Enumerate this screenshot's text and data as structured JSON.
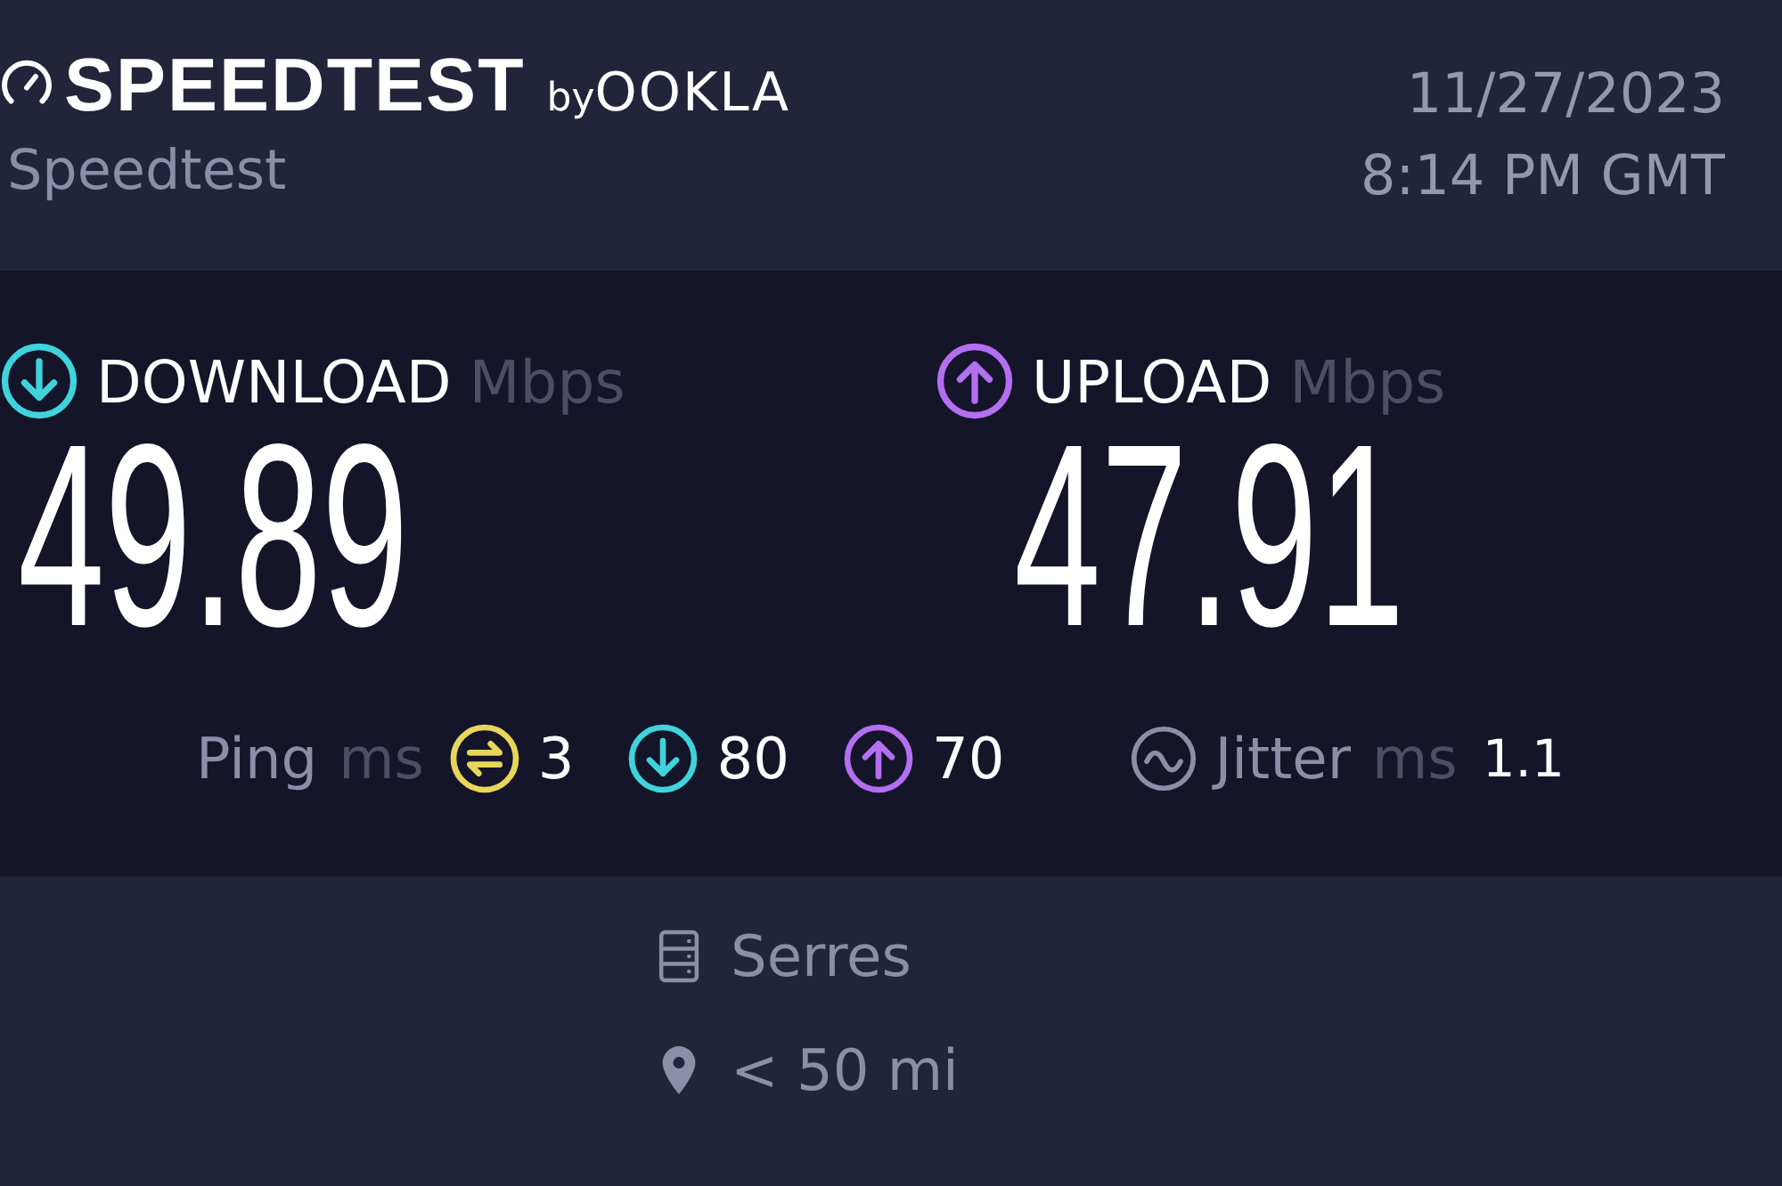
{
  "header": {
    "logo": "SPEEDTEST",
    "logo_by": "by",
    "logo_brand": "OOKLA",
    "handle": "Speedtest",
    "date": "11/27/2023",
    "time": "8:14 PM GMT"
  },
  "results": [
    {
      "kind": "download",
      "label": "DOWNLOAD",
      "unit": "Mbps",
      "value": "49.89",
      "color": "#3fd3dc"
    },
    {
      "kind": "upload",
      "label": "UPLOAD",
      "unit": "Mbps",
      "value": "47.91",
      "color": "#b36ff0"
    }
  ],
  "ping": {
    "label": "Ping",
    "unit": "ms",
    "items": [
      {
        "kind": "idle",
        "value": "3",
        "color": "#e8d65a"
      },
      {
        "kind": "download",
        "value": "80",
        "color": "#3fd3dc"
      },
      {
        "kind": "upload",
        "value": "70",
        "color": "#b36ff0"
      }
    ]
  },
  "jitter": {
    "label": "Jitter",
    "unit": "ms",
    "value": "1.1"
  },
  "server": {
    "name": "Serres",
    "distance": "< 50 mi"
  }
}
